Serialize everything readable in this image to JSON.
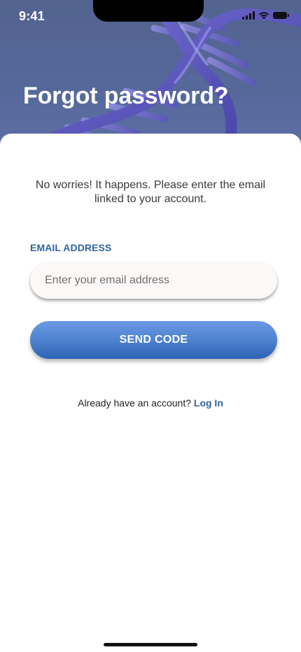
{
  "status_bar": {
    "time": "9:41"
  },
  "header": {
    "title": "Forgot password?"
  },
  "form": {
    "subtitle": "No worries! It happens. Please enter the email linked to your account.",
    "email_label": "EMAIL ADDRESS",
    "email_placeholder": "Enter your email address",
    "email_value": "",
    "submit_label": "SEND CODE"
  },
  "footer": {
    "prompt": "Already have an account?",
    "login_label": "Log In"
  },
  "colors": {
    "accent": "#2f63a3",
    "button_top": "#6a9be2",
    "button_bottom": "#2d63b4",
    "hero_background": "#56689a"
  },
  "icons": [
    "cellular-signal-icon",
    "wifi-icon",
    "battery-icon",
    "dna-helix-image"
  ]
}
